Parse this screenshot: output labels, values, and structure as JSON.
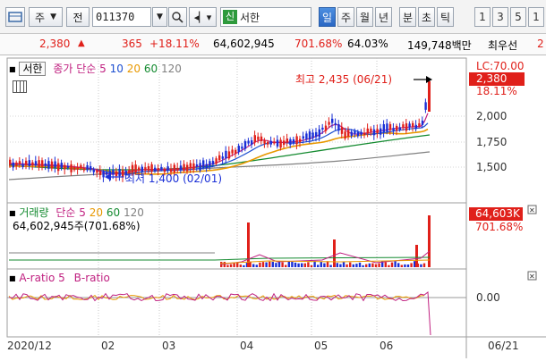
{
  "toolbar": {
    "view_label": "주",
    "jeon_label": "전",
    "stock_code": "011370",
    "stock_name": "서한",
    "sin_badge": "신",
    "periods": [
      "일",
      "주",
      "월",
      "년",
      "분",
      "초",
      "틱"
    ],
    "numbers": [
      "1",
      "3",
      "5",
      "1"
    ]
  },
  "price_bar": {
    "price": "2,380",
    "change": "365",
    "change_pct": "+18.11%",
    "volume": "64,602,945",
    "volume_ratio": "701.68%",
    "turnover": "64.03%",
    "amount": "149,748백만",
    "label_last": "최우선",
    "trailing": "2"
  },
  "price_panel": {
    "stock_tag": "서한",
    "legend_type": "종가",
    "ma_label": "단순",
    "ma_periods": [
      "5",
      "10",
      "20",
      "60",
      "120"
    ],
    "high_note": "최고 2,435 (06/21)",
    "low_note": "최저 1,400 (02/01)",
    "axis_ticks": [
      "2,000",
      "1,750",
      "1,500"
    ],
    "lc_label": "LC:70.00",
    "current_price_tag": "2,380",
    "current_pct_tag": "18.11%"
  },
  "volume_panel": {
    "legend_name": "거래량",
    "ma_label": "단순",
    "ma_periods": [
      "5",
      "20",
      "60",
      "120"
    ],
    "value_text": "64,602,945주(701.68%)",
    "tag_value": "64,603K",
    "tag_pct": "701.68%"
  },
  "ratio_panel": {
    "legend_a": "A-ratio 5",
    "legend_b": "B-ratio",
    "axis_tick": "0.00"
  },
  "x_axis": {
    "labels": [
      "2020/12",
      "02",
      "03",
      "04",
      "05",
      "06"
    ],
    "current_date": "06/21"
  },
  "colors": {
    "up": "#e0201a",
    "down": "#1a2fd6",
    "ma5": "#c02080",
    "ma10": "#1d4fd0",
    "ma20": "#e89800",
    "ma60": "#138a2f",
    "ma120": "#808080",
    "accent_tag": "#e0201a"
  }
}
